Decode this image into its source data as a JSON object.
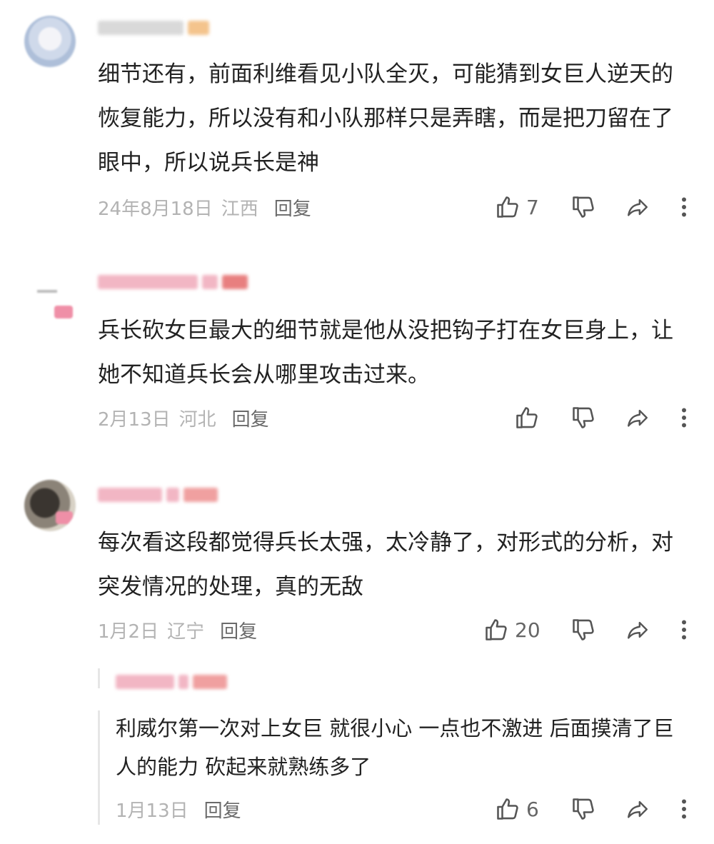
{
  "comments": [
    {
      "text": "细节还有，前面利维看见小队全灭，可能猜到女巨人逆天的恢复能力，所以没有和小队那样只是弄瞎，而是把刀留在了眼中，所以说兵长是神",
      "date": "24年8月18日",
      "location": "江西",
      "reply_label": "回复",
      "likes": "7"
    },
    {
      "text": "兵长砍女巨最大的细节就是他从没把钩子打在女巨身上，让她不知道兵长会从哪里攻击过来。",
      "date": "2月13日",
      "location": "河北",
      "reply_label": "回复",
      "likes": ""
    },
    {
      "text": "每次看这段都觉得兵长太强，太冷静了，对形式的分析，对突发情况的处理，真的无敌",
      "date": "1月2日",
      "location": "辽宁",
      "reply_label": "回复",
      "likes": "20"
    }
  ],
  "reply": {
    "text": "利威尔第一次对上女巨  就很小心 一点也不激进 后面摸清了巨人的能力  砍起来就熟练多了",
    "date": "1月13日",
    "reply_label": "回复",
    "likes": "6"
  },
  "icons": {
    "like": "thumbs-up-icon",
    "dislike": "thumbs-down-icon",
    "share": "share-icon",
    "more": "more-vertical-icon"
  },
  "colors": {
    "text": "#222222",
    "meta": "#b3b3b3",
    "reply_link": "#6a6a6a",
    "icon": "#555555",
    "blur_pink": "#f3a6b8",
    "blur_red": "#e86a6a"
  }
}
